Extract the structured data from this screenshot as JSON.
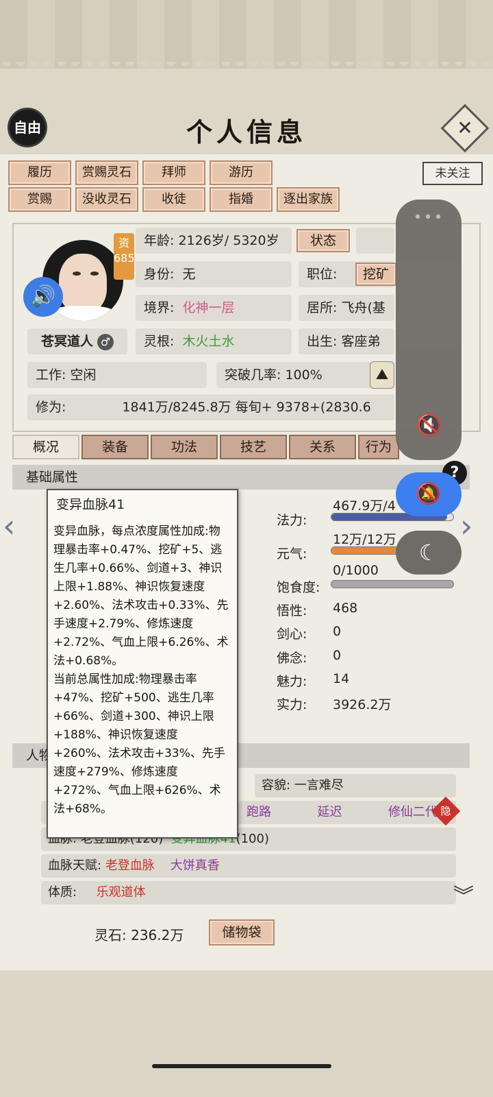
{
  "header": {
    "title": "个人信息",
    "mode_button": "自由",
    "close": "✕"
  },
  "actions": {
    "row1": [
      "履历",
      "赏赐灵石",
      "拜师",
      "游历"
    ],
    "row2": [
      "赏赐",
      "没收灵石",
      "收徒",
      "指婚",
      "逐出家族"
    ],
    "follow": "未关注"
  },
  "profile": {
    "name": "苍冥道人",
    "aptitude_label": "资",
    "aptitude_value": "685",
    "age": "年龄: 2126岁/ 5320岁",
    "status_button": "状态",
    "identity_label": "身份:",
    "identity": "无",
    "position_label": "职位:",
    "position_button": "挖矿",
    "realm_label": "境界:",
    "realm": "化神一层",
    "residence": "居所: 飞舟(基",
    "root_label": "灵根:",
    "root": "木火土水",
    "birth": "出生:   客座弟",
    "work": "工作: 空闲",
    "breakthrough": "突破几率:  100%",
    "cultivation_label": "修为:",
    "cultivation": "1841万/8245.8万  每旬+   9378+(2830.6"
  },
  "tabs": [
    "概况",
    "装备",
    "功法",
    "技艺",
    "关系",
    "行为"
  ],
  "base_attr": {
    "heading": "基础属性",
    "stats": [
      {
        "label": "法力:",
        "value": "467.9万/4",
        "fill": 0.95,
        "color": "#4a5ea8"
      },
      {
        "label": "元气:",
        "value": "12万/12万",
        "fill": 1.0,
        "color": "#e08a3a"
      },
      {
        "label": "饱食度:",
        "value": "0/1000",
        "fill": 0.0,
        "color": "#9a9a9a"
      }
    ],
    "plain": [
      {
        "label": "悟性:",
        "value": "468"
      },
      {
        "label": "剑心:",
        "value": "0"
      },
      {
        "label": "佛念:",
        "value": "0"
      },
      {
        "label": "魅力:",
        "value": "14"
      },
      {
        "label": "实力:",
        "value": "3926.2万"
      }
    ]
  },
  "tooltip": {
    "title": "变异血脉41",
    "body": "变异血脉，每点浓度属性加成:物理暴击率+0.47%、挖矿+5、逃生几率+0.66%、剑道+3、神识上限+1.88%、神识恢复速度+2.60%、法术攻击+0.33%、先手速度+2.79%、修炼速度+2.72%、气血上限+6.26%、术法+0.68%。\n当前总属性加成:物理暴击率+47%、挖矿+500、逃生几率+66%、剑道+300、神识上限+188%、神识恢复速度+260%、法术攻击+33%、先手速度+279%、修炼速度+272%、气血上限+626%、术法+68%。"
  },
  "person": {
    "heading": "人物",
    "appearance": "容貌:    一言难尽",
    "traits": [
      "跑路",
      "延迟",
      "修仙二代"
    ],
    "hidden_badge": "隐",
    "bloodline_label": "血脉:",
    "bloodline_a": "老登血脉(120)",
    "bloodline_b": "变异血脉41",
    "bloodline_b_val": "(100)",
    "talent_label": "血脉天赋:",
    "talent_a": "老登血脉",
    "talent_b": "大饼真香",
    "physique_label": "体质:",
    "physique": "乐观道体"
  },
  "footer": {
    "stones": "灵石: 236.2万",
    "bag": "储物袋"
  }
}
